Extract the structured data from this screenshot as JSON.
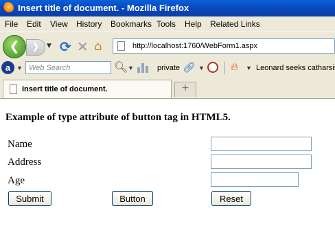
{
  "window": {
    "title": "Insert title of document. - Mozilla Firefox"
  },
  "menu": {
    "items": [
      "File",
      "Edit",
      "View",
      "History",
      "Bookmarks",
      "Tools",
      "Help",
      "Related Links"
    ]
  },
  "nav": {
    "back_glyph": "❮",
    "forward_glyph": "❯",
    "reload_glyph": "⟳",
    "stop_glyph": "✕",
    "home_glyph": "⌂",
    "url": "http://localhost:1760/WebForm1.aspx"
  },
  "toolbar": {
    "ask_logo": "a",
    "search_placeholder": "Web Search",
    "private_label": "private",
    "news_text": "Leonard seeks catharsis"
  },
  "tabs": [
    {
      "label": "Insert title of document."
    }
  ],
  "new_tab_glyph": "+",
  "page": {
    "heading": "Example of type attribute of  button tag in HTML5.",
    "fields": [
      {
        "label": "Name",
        "value": ""
      },
      {
        "label": "Address",
        "value": ""
      },
      {
        "label": "Age",
        "value": ""
      }
    ],
    "buttons": {
      "submit": "Submit",
      "button": "Button",
      "reset": "Reset"
    }
  }
}
